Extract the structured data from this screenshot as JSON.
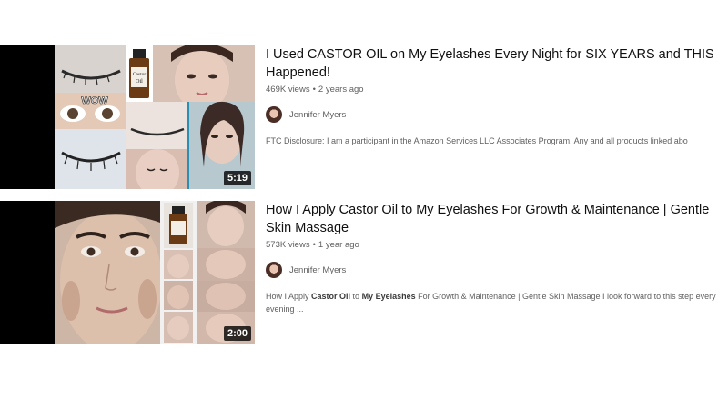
{
  "results": [
    {
      "title": "I Used CASTOR OIL on My Eyelashes Every Night for SIX YEARS and THIS Happened!",
      "views": "469K views",
      "age": "2 years ago",
      "channel": "Jennifer Myers",
      "description": "FTC Disclosure: I am a participant in the Amazon Services LLC Associates Program. Any and all products linked abo",
      "duration": "5:19",
      "thumbnail_text": "WOW",
      "bottle_label": "Castor Oil"
    },
    {
      "title": "How I Apply Castor Oil to My Eyelashes For Growth & Maintenance | Gentle Skin Massage",
      "views": "573K views",
      "age": "1 year ago",
      "channel": "Jennifer Myers",
      "description_parts": {
        "p1": "How I Apply ",
        "b1": "Castor Oil",
        "p2": " to ",
        "b2": "My Eyelashes",
        "p3": " For Growth & Maintenance | Gentle Skin Massage I look forward to this step every evening ..."
      },
      "duration": "2:00"
    }
  ],
  "meta_separator": "•"
}
